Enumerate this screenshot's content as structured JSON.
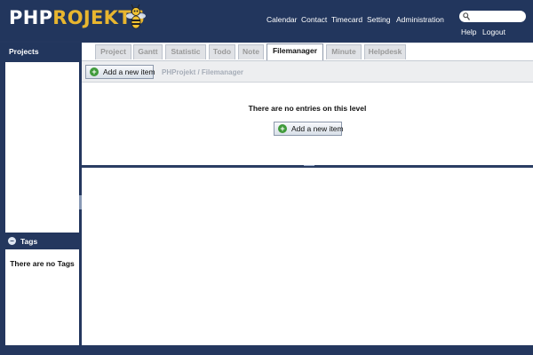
{
  "app": {
    "logo_part1": "PHP",
    "logo_part2": "ROJEKT6"
  },
  "topnav": {
    "items": [
      {
        "label": "Calendar"
      },
      {
        "label": "Contact"
      },
      {
        "label": "Timecard"
      },
      {
        "label": "Setting"
      },
      {
        "label": "Administration"
      }
    ]
  },
  "utilnav": {
    "help": "Help",
    "logout": "Logout"
  },
  "sidebar": {
    "projects_title": "Projects",
    "tags_title": "Tags",
    "tags_empty": "There are no Tags"
  },
  "tabs": [
    {
      "label": "Project",
      "active": false
    },
    {
      "label": "Gantt",
      "active": false
    },
    {
      "label": "Statistic",
      "active": false
    },
    {
      "label": "Todo",
      "active": false
    },
    {
      "label": "Note",
      "active": false
    },
    {
      "label": "Filemanager",
      "active": true
    },
    {
      "label": "Minute",
      "active": false
    },
    {
      "label": "Helpdesk",
      "active": false
    }
  ],
  "toolbar": {
    "add_label": "Add a new item",
    "breadcrumb": "PHProjekt / Filemanager"
  },
  "main": {
    "empty_message": "There are no entries on this level",
    "add_label": "Add a new item"
  },
  "icons": {
    "search": "search-icon",
    "add": "plus-circle-icon",
    "tags": "collapse-icon",
    "mascot": "bee-icon"
  },
  "colors": {
    "header_bg": "#22365d",
    "logo_accent": "#e8b62f",
    "add_icon": "#3f9a3a"
  }
}
